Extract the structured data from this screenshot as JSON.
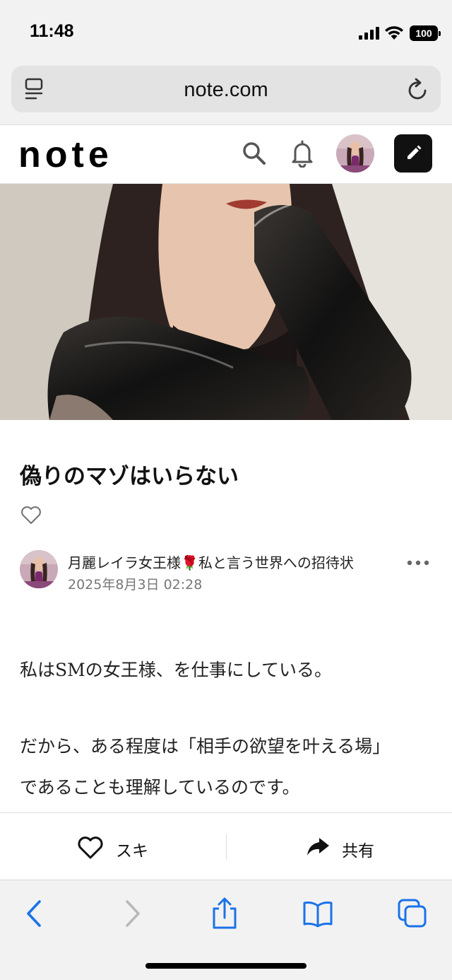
{
  "status_bar": {
    "time": "11:48",
    "battery": "100"
  },
  "browser": {
    "url": "note.com"
  },
  "site": {
    "logo": "note"
  },
  "article": {
    "title": "偽りのマゾはいらない",
    "author": "月麗レイラ女王様🌹私と言う世界への招待状",
    "date": "2025年8月3日 02:28",
    "paragraphs": [
      "私はSMの女王様、を仕事にしている。",
      "だから、ある程度は「相手の欲望を叶える場」",
      "であることも理解しているのです。"
    ]
  },
  "actions": {
    "like_label": "スキ",
    "share_label": "共有"
  },
  "colors": {
    "accent_blue": "#1a73e8",
    "header_button": "#111111"
  },
  "icons": [
    "search-icon",
    "bell-icon",
    "pencil-icon",
    "heart-icon",
    "share-arrow-icon",
    "back-chevron-icon",
    "forward-chevron-icon",
    "share-icon",
    "bookmarks-icon",
    "tabs-icon",
    "reload-icon",
    "reader-icon",
    "more-icon"
  ]
}
